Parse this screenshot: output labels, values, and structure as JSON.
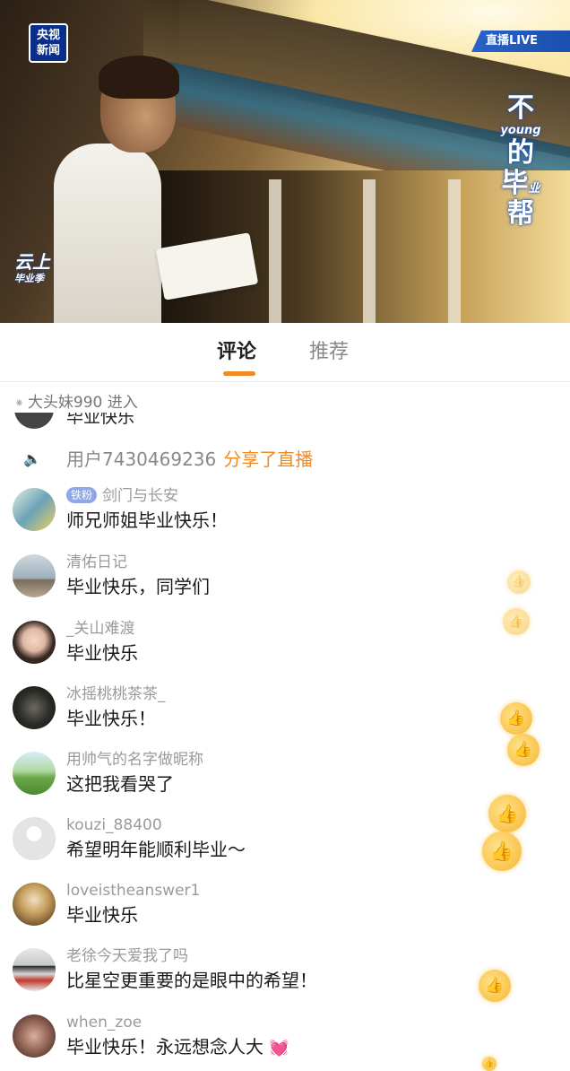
{
  "video": {
    "channel_logo": "央视\n新闻",
    "live_tag": "直播LIVE",
    "show_title_1": "不",
    "show_title_en": "young",
    "show_title_2": "的",
    "show_title_3": "毕",
    "show_title_4": "业",
    "show_title_5": "帮",
    "side_logo_main": "云上",
    "side_logo_sub": "毕业季"
  },
  "tabs": {
    "comments": "评论",
    "recommend": "推荐"
  },
  "feed": {
    "enter_notice": "大头妹990 进入",
    "clipped_text": "毕业快乐",
    "share_user": "用户7430469236",
    "share_action": "分享了直播",
    "comments": [
      {
        "name": "剑门与长安",
        "badge": "铁粉",
        "text": "师兄师姐毕业快乐！"
      },
      {
        "name": "清佑日记",
        "text": "毕业快乐，同学们"
      },
      {
        "name": "_关山难渡",
        "text": "毕业快乐"
      },
      {
        "name": "冰摇桃桃茶茶_",
        "text": "毕业快乐！"
      },
      {
        "name": "用帅气的名字做昵称",
        "text": "这把我看哭了"
      },
      {
        "name": "kouzi_88400",
        "text": "希望明年能顺利毕业～"
      },
      {
        "name": "loveistheanswer1",
        "text": "毕业快乐"
      },
      {
        "name": "老徐今天爱我了吗",
        "text": "比星空更重要的是眼中的希望！"
      },
      {
        "name": "when_zoe",
        "text": "毕业快乐！永远想念人大"
      }
    ]
  },
  "icons": {
    "speaker": "🔈",
    "thumb": "👍",
    "heart": "💓",
    "enter": "⁕"
  }
}
